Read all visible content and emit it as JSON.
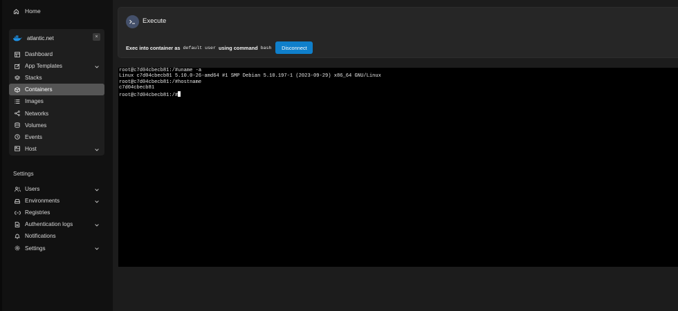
{
  "sidebar": {
    "home_label": "Home",
    "environment": {
      "name": "atlantic.net",
      "close_glyph": "×"
    },
    "items": [
      {
        "label": "Dashboard",
        "icon": "dashboard-icon",
        "chevron": false,
        "active": false
      },
      {
        "label": "App Templates",
        "icon": "edit-icon",
        "chevron": true,
        "active": false
      },
      {
        "label": "Stacks",
        "icon": "stacks-icon",
        "chevron": false,
        "active": false
      },
      {
        "label": "Containers",
        "icon": "cube-icon",
        "chevron": false,
        "active": true
      },
      {
        "label": "Images",
        "icon": "list-icon",
        "chevron": false,
        "active": false
      },
      {
        "label": "Networks",
        "icon": "share-icon",
        "chevron": false,
        "active": false
      },
      {
        "label": "Volumes",
        "icon": "database-icon",
        "chevron": false,
        "active": false
      },
      {
        "label": "Events",
        "icon": "clock-icon",
        "chevron": false,
        "active": false
      },
      {
        "label": "Host",
        "icon": "server-icon",
        "chevron": true,
        "active": false
      }
    ],
    "settings_title": "Settings",
    "settings_items": [
      {
        "label": "Users",
        "icon": "users-icon",
        "chevron": true
      },
      {
        "label": "Environments",
        "icon": "environment-icon",
        "chevron": true
      },
      {
        "label": "Registries",
        "icon": "registry-icon",
        "chevron": false
      },
      {
        "label": "Authentication logs",
        "icon": "file-icon",
        "chevron": true
      },
      {
        "label": "Notifications",
        "icon": "bell-icon",
        "chevron": false
      },
      {
        "label": "Settings",
        "icon": "gear-icon",
        "chevron": true
      }
    ]
  },
  "exec": {
    "title": "Execute",
    "prefix": "Exec into container as",
    "user": "default user",
    "middle": "using command",
    "command": "bash",
    "button": "Disconnect"
  },
  "terminal": {
    "lines": [
      "root@c7d04cbecb81:/#uname -a",
      "Linux c7d04cbecb81 5.10.0-26-amd64 #1 SMP Debian 5.10.197-1 (2023-09-29) x86_64 GNU/Linux",
      "root@c7d04cbecb81:/#hostname",
      "c7d04cbecb81",
      "root@c7d04cbecb81:/#"
    ]
  },
  "colors": {
    "accent": "#0f7fcb",
    "sidebar_bg": "#111111",
    "active_item": "#555555",
    "terminal_bg": "#000000"
  }
}
